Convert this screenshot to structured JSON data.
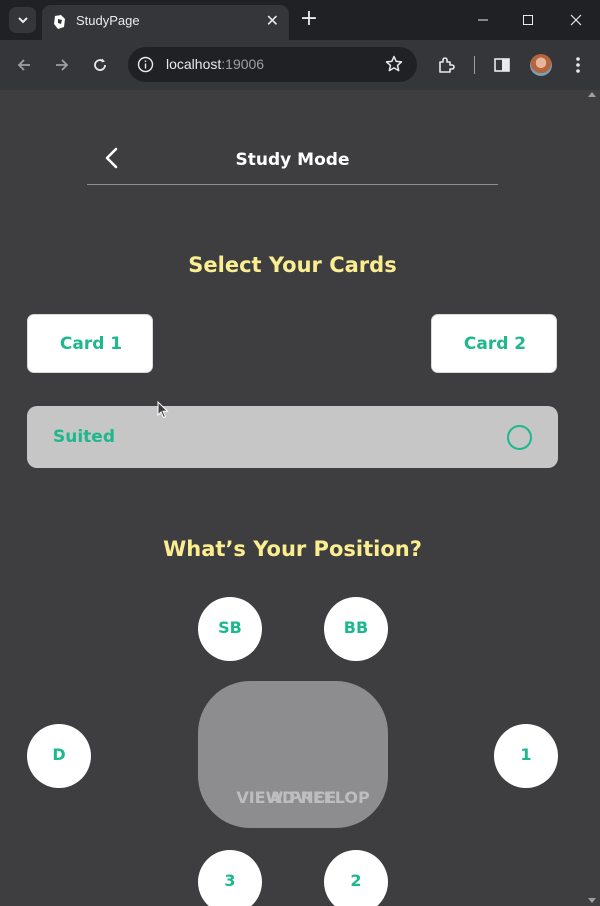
{
  "browser": {
    "tab_title": "StudyPage",
    "url_host": "localhost",
    "url_port": ":19006"
  },
  "page": {
    "title": "Study Mode",
    "cards_heading": "Select Your Cards",
    "card1_label": "Card 1",
    "card2_label": "Card 2",
    "suited_label": "Suited",
    "suited_selected": false,
    "position_heading": "What’s Your Position?",
    "seats": {
      "sb": "SB",
      "bb": "BB",
      "d": "D",
      "one": "1",
      "two": "2",
      "three": "3"
    },
    "advice_line1": "VIEW PREFLOP",
    "advice_line2": "ADVICE"
  },
  "colors": {
    "background": "#3e3d3f",
    "accent_green": "#1db88e",
    "heading_yellow": "#fbee91"
  }
}
